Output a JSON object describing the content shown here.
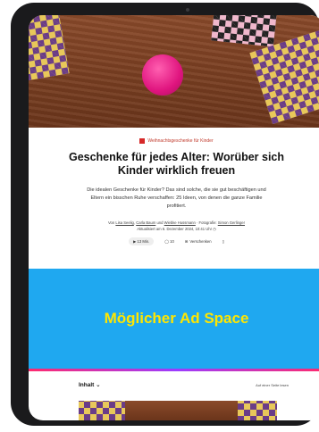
{
  "article": {
    "kicker": "Weihnachtsgeschenke für Kinder",
    "headline": "Geschenke für jedes Alter: Worüber sich Kinder wirklich freuen",
    "teaser": "Die idealen Geschenke für Kinder? Das sind solche, die sie gut beschäftigen und Eltern ein bisschen Ruhe verschaffen: 25 Ideen, von denen die ganze Familie profitiert.",
    "authors_prefix": "Von",
    "author1": "Lisa Seelig",
    "sep1": ",",
    "author2": "Carla Baum",
    "and": "und",
    "author3": "Wiebke Hussmann",
    "photo_prefix": "· Fotografie:",
    "photographer": "Simon Gerlinger",
    "updated": "Aktualisiert am 6. Dezember 2024, 10:41 Uhr"
  },
  "actions": {
    "listen": "▶ 13 Min.",
    "comments": "◯ 10",
    "share": "Verschenken",
    "save_icon": "bookmark-icon"
  },
  "ad": {
    "label": "Möglicher Ad Space"
  },
  "toc": {
    "label": "Inhalt ⌄",
    "right": "Auf einer Seite lesen"
  },
  "colors": {
    "ad_bg": "#1fa8f0",
    "ad_text": "#ffe600",
    "kicker": "#d62828"
  }
}
